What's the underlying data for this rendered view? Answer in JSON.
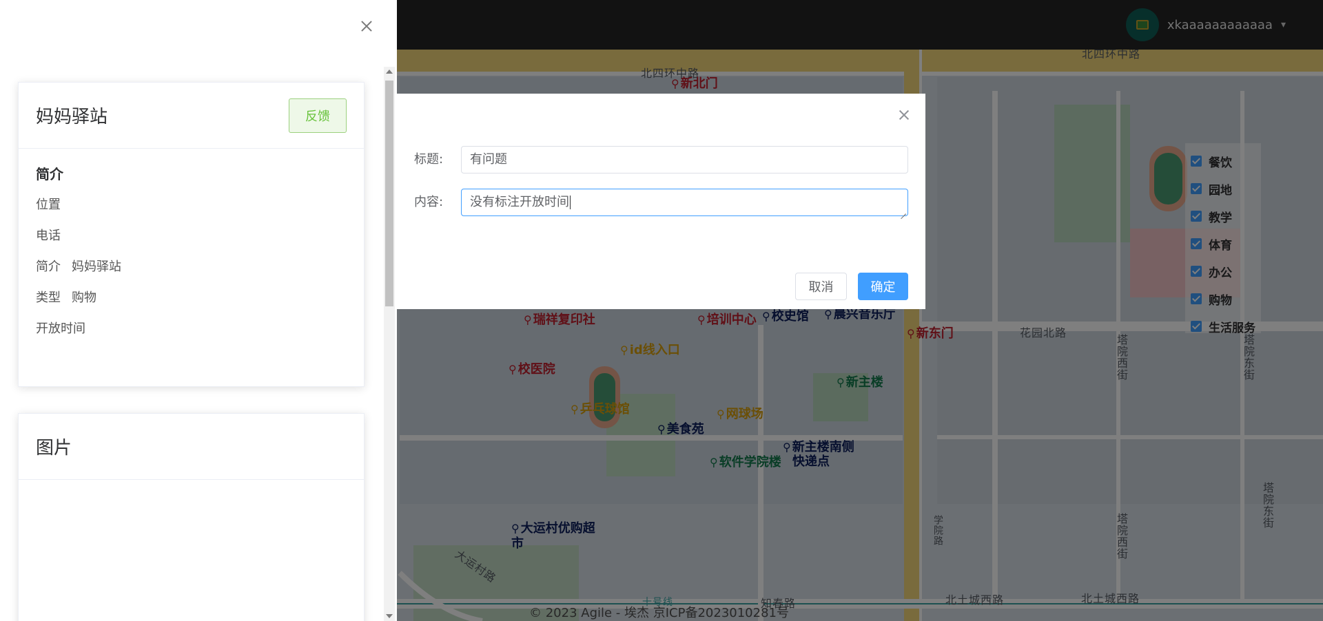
{
  "header": {
    "username": "xkaaaaaaaaaaaa"
  },
  "map": {
    "labels": [
      {
        "text": "新北门",
        "color": "red"
      },
      {
        "text": "瑞祥复印社",
        "color": "red"
      },
      {
        "text": "培训中心",
        "color": "red"
      },
      {
        "text": "校史馆",
        "color": "blue"
      },
      {
        "text": "晨兴音乐厅",
        "color": "blue"
      },
      {
        "text": "新东门",
        "color": "red"
      },
      {
        "text": "id线入口",
        "color": "yellow"
      },
      {
        "text": "校医院",
        "color": "red"
      },
      {
        "text": "新主楼",
        "color": "green"
      },
      {
        "text": "乒乓球馆",
        "color": "yellow"
      },
      {
        "text": "网球场",
        "color": "yellow"
      },
      {
        "text": "美食苑",
        "color": "blue"
      },
      {
        "text": "新主楼南侧",
        "color": "blue"
      },
      {
        "text": "快递点",
        "color": "blue"
      },
      {
        "text": "软件学院楼",
        "color": "green"
      },
      {
        "text": "大运村优购超市",
        "color": "blue"
      }
    ],
    "roads": [
      "北四环中路",
      "北四环中路",
      "花园北路",
      "塔院西街",
      "塔院东街",
      "塔院西街",
      "塔院东街",
      "大运村路",
      "知春路",
      "北土城西路",
      "北土城西路",
      "学院路",
      "十号线"
    ],
    "footer": "© 2023 Agile - 埃杰 京ICP备2023010281号",
    "legend": [
      "餐饮",
      "园地",
      "教学",
      "体育",
      "办公",
      "购物",
      "生活服务"
    ]
  },
  "drawer": {
    "place_name": "妈妈驿站",
    "feedback_label": "反馈",
    "section_title": "简介",
    "rows": [
      {
        "key": "位置",
        "value": ""
      },
      {
        "key": "电话",
        "value": ""
      },
      {
        "key": "简介",
        "value": "妈妈驿站"
      },
      {
        "key": "类型",
        "value": "购物"
      },
      {
        "key": "开放时间",
        "value": ""
      }
    ],
    "pictures_title": "图片"
  },
  "dialog": {
    "title_label": "标题:",
    "title_value": "有问题",
    "content_label": "内容:",
    "content_value": "没有标注开放时间",
    "cancel_label": "取消",
    "confirm_label": "确定"
  },
  "colors": {
    "primary": "#409eff",
    "success": "#67c23a",
    "header_bg": "#242424"
  }
}
